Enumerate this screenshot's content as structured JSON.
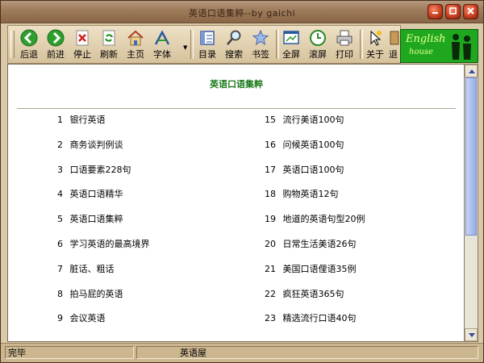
{
  "window": {
    "title": "英语口语集粹--by gaichi",
    "buttons": [
      "minimize",
      "restore",
      "close"
    ]
  },
  "toolbar": {
    "back": "后退",
    "forward": "前进",
    "stop": "停止",
    "refresh": "刷新",
    "home": "主页",
    "font": "字体",
    "contents": "目录",
    "search": "搜索",
    "bookmark": "书签",
    "fullscreen": "全屏",
    "scroll": "滚屏",
    "print": "打印",
    "about": "关于",
    "exit": "退"
  },
  "logo": {
    "text": "English",
    "sub": "house"
  },
  "content": {
    "title": "英语口语集粹",
    "left_items": [
      {
        "num": "1",
        "label": "银行英语"
      },
      {
        "num": "2",
        "label": "商务谈判例谈"
      },
      {
        "num": "3",
        "label": "口语要素228句"
      },
      {
        "num": "4",
        "label": "英语口语精华"
      },
      {
        "num": "5",
        "label": "英语口语集粹"
      },
      {
        "num": "6",
        "label": "学习英语的最高境界"
      },
      {
        "num": "7",
        "label": "脏话、粗话"
      },
      {
        "num": "8",
        "label": "拍马屁的英语"
      },
      {
        "num": "9",
        "label": "会议英语"
      }
    ],
    "right_items": [
      {
        "num": "15",
        "label": "流行美语100句"
      },
      {
        "num": "16",
        "label": "问候英语100句"
      },
      {
        "num": "17",
        "label": "英语口语100句"
      },
      {
        "num": "18",
        "label": "购物英语12句"
      },
      {
        "num": "19",
        "label": "地道的英语句型20例"
      },
      {
        "num": "20",
        "label": "日常生活美语26句"
      },
      {
        "num": "21",
        "label": "美国口语俚语35例"
      },
      {
        "num": "22",
        "label": "疯狂英语365句"
      },
      {
        "num": "23",
        "label": "精选流行口语40句"
      }
    ]
  },
  "statusbar": {
    "status": "完毕",
    "section": "英语屋"
  },
  "colors": {
    "accent_green": "#1b7a1b",
    "frame": "#9c7a5a",
    "scroll_thumb": "#aabdf0"
  }
}
